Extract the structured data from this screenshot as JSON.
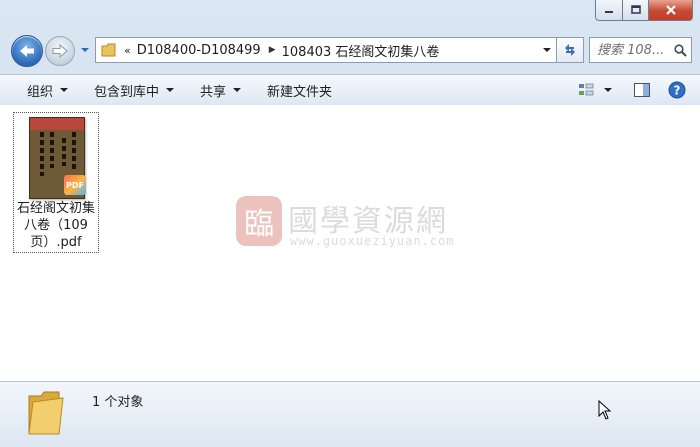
{
  "address": {
    "overflow_marker": "«",
    "crumbs": [
      "D108400-D108499",
      "108403 石经阁文初集八卷"
    ]
  },
  "search": {
    "placeholder": "搜索 108..."
  },
  "toolbar": {
    "organize": "组织",
    "include_in_library": "包含到库中",
    "share": "共享",
    "new_folder": "新建文件夹"
  },
  "files": [
    {
      "name": "石经阁文初集八卷（109页）.pdf",
      "type_badge": "PDF"
    }
  ],
  "watermark": {
    "logo_char": "臨",
    "title": "國學資源網",
    "url": "www.guoxueziyuan.com"
  },
  "details": {
    "count": "1 个对象"
  },
  "icons": {
    "minimize": "minimize-icon",
    "maximize": "maximize-icon",
    "close": "close-icon",
    "back": "back-arrow-icon",
    "forward": "forward-arrow-icon",
    "refresh": "refresh-icon",
    "search": "search-icon",
    "view": "view-options-icon",
    "preview_pane": "preview-pane-icon",
    "help": "help-icon",
    "folder": "folder-icon",
    "cursor": "mouse-cursor-icon"
  },
  "colors": {
    "close_button": "#c74a33",
    "back_button": "#2c69b8",
    "help_blue": "#2f6fc4",
    "pdf_badge": "#ff6a5a"
  }
}
